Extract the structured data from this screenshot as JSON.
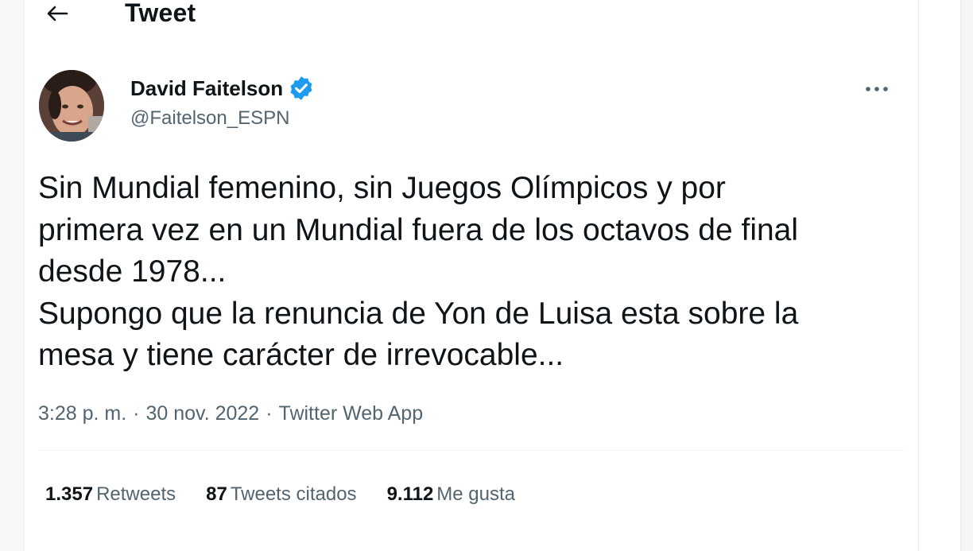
{
  "header": {
    "title": "Tweet"
  },
  "tweet": {
    "author": {
      "name": "David Faitelson",
      "handle": "@Faitelson_ESPN",
      "verified": true
    },
    "text": "Sin Mundial femenino, sin Juegos Olímpicos y por\nprimera vez en un Mundial fuera de los octavos de final\ndesde 1978...\nSupongo que la renuncia de Yon de Luisa esta sobre la\nmesa y tiene carácter de irrevocable...",
    "time": "3:28 p. m.",
    "separator": "·",
    "date": "30 nov. 2022",
    "source": "Twitter Web App"
  },
  "stats": [
    {
      "count": "1.357",
      "label": "Retweets"
    },
    {
      "count": "87",
      "label": "Tweets citados"
    },
    {
      "count": "9.112",
      "label": "Me gusta"
    }
  ],
  "colors": {
    "verified": "#1d9bf0",
    "text_primary": "#0f1419",
    "text_secondary": "#536471"
  }
}
